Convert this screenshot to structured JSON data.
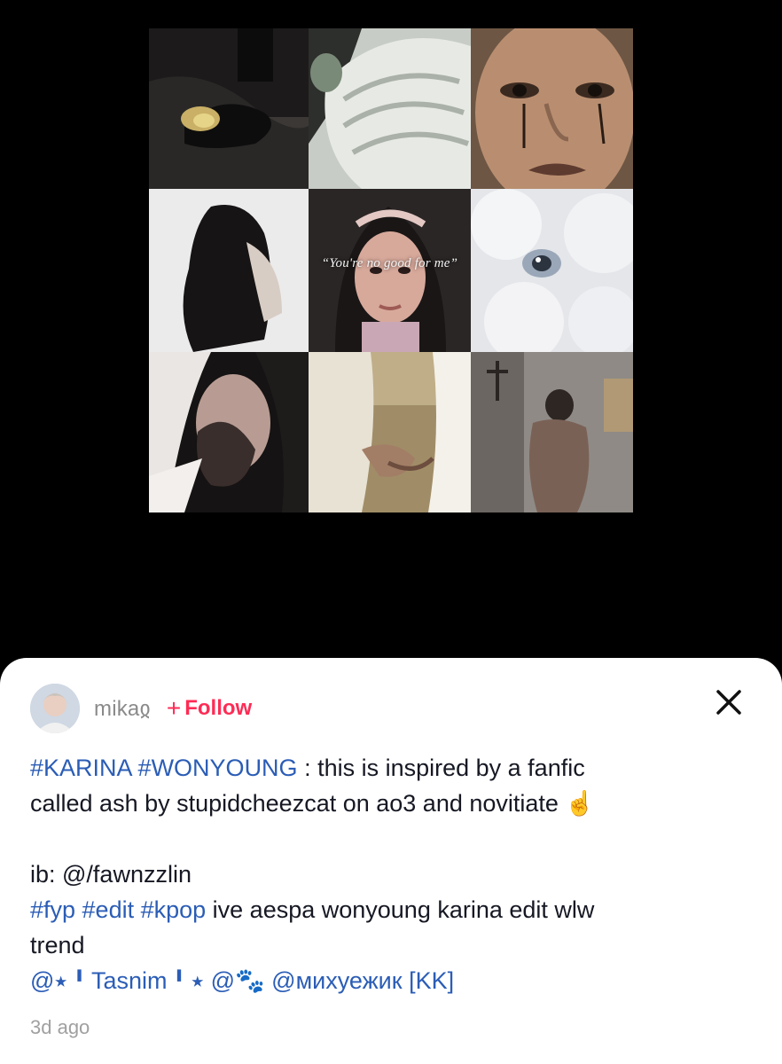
{
  "video": {
    "overlay_quote": "“You're no good for me”",
    "tiles": [
      "fallen-figure",
      "angel-wing",
      "crying-statue",
      "long-hair-girl",
      "nun-portrait",
      "white-fur-eye",
      "nun-hands",
      "holding-hands",
      "crucifix-wall"
    ]
  },
  "post": {
    "username": "mikaჲ",
    "follow_label": "Follow",
    "follow_color": "#fe2c55",
    "hashtag_color": "#2b5db6",
    "caption": {
      "line1_tags": "#KARINA #WONYOUNG",
      "line1_text": " : this is inspired by a fanfic",
      "line2_text": "called ash by stupidcheezcat on ao3 and  novitiate ☝️",
      "line3_text": "ib: @/fawnzzlin",
      "line4_tags": "#fyp #edit #kpop",
      "line4_text": " ive aespa  wonyoung karina edit wlw",
      "line5_text": "trend",
      "mention1": "@⭑╹Tasnim╹⭑",
      "mention2": "@🐾",
      "mention3": "@михуежик [KK]"
    },
    "timestamp": "3d ago"
  },
  "icons": {
    "close": "close-icon",
    "follow": "plus-icon",
    "avatar": "avatar"
  }
}
